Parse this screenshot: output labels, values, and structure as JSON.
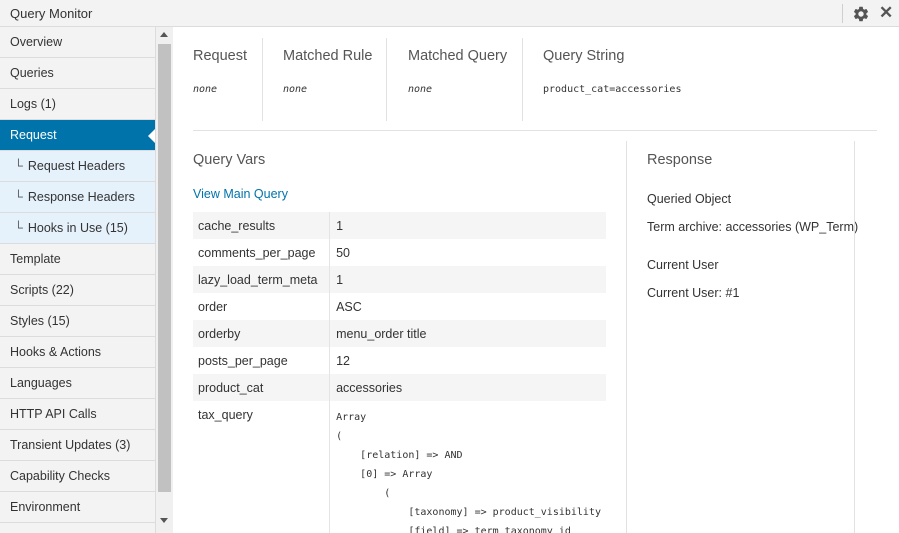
{
  "app": {
    "title": "Query Monitor"
  },
  "titlebar": {
    "settings_icon": "gear-icon",
    "close_icon": "close-icon",
    "close_glyph": "✕"
  },
  "sidebar": {
    "items": [
      {
        "label": "Overview"
      },
      {
        "label": "Queries"
      },
      {
        "label": "Logs (1)"
      },
      {
        "label": "Request",
        "active": true
      },
      {
        "label": "Request Headers",
        "sub": true
      },
      {
        "label": "Response Headers",
        "sub": true
      },
      {
        "label": "Hooks in Use (15)",
        "sub": true
      },
      {
        "label": "Template"
      },
      {
        "label": "Scripts (22)"
      },
      {
        "label": "Styles (15)"
      },
      {
        "label": "Hooks & Actions"
      },
      {
        "label": "Languages"
      },
      {
        "label": "HTTP API Calls"
      },
      {
        "label": "Transient Updates (3)"
      },
      {
        "label": "Capability Checks"
      },
      {
        "label": "Environment"
      }
    ],
    "tree_glyph": "└"
  },
  "request": {
    "columns": [
      {
        "title": "Request",
        "value": "none"
      },
      {
        "title": "Matched Rule",
        "value": "none"
      },
      {
        "title": "Matched Query",
        "value": "none"
      },
      {
        "title": "Query String",
        "value": "product_cat=accessories"
      }
    ]
  },
  "query_vars": {
    "title": "Query Vars",
    "link": "View Main Query",
    "rows": [
      {
        "key": "cache_results",
        "value": "1"
      },
      {
        "key": "comments_per_page",
        "value": "50"
      },
      {
        "key": "lazy_load_term_meta",
        "value": "1"
      },
      {
        "key": "order",
        "value": "ASC"
      },
      {
        "key": "orderby",
        "value": "menu_order title"
      },
      {
        "key": "posts_per_page",
        "value": "12"
      },
      {
        "key": "product_cat",
        "value": "accessories"
      },
      {
        "key": "tax_query",
        "value": "Array\n(\n    [relation] => AND\n    [0] => Array\n        (\n            [taxonomy] => product_visibility\n            [field] => term_taxonomy_id"
      }
    ]
  },
  "response": {
    "title": "Response",
    "queried_object_label": "Queried Object",
    "queried_object_value": "Term archive: accessories (WP_Term)",
    "current_user_label": "Current User",
    "current_user_value": "Current User: #1"
  }
}
